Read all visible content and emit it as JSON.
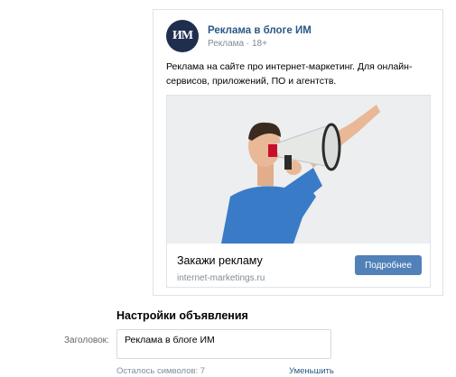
{
  "post": {
    "avatar_text": "ИМ",
    "title": "Реклама в блоге ИМ",
    "subtitle": "Реклама · 18+",
    "text": "Реклама на сайте про интернет-маркетинг. Для онлайн-сервисов, приложений, ПО и агентств."
  },
  "promo": {
    "image_icon": "megaphone-man-photo",
    "title": "Закажи рекламу",
    "domain": "internet-marketings.ru",
    "button_label": "Подробнее"
  },
  "settings": {
    "title": "Настройки объявления",
    "headline_label": "Заголовок:",
    "headline_value": "Реклама в блоге ИМ",
    "chars_left": "Осталось символов: 7",
    "reduce_link": "Уменьшить"
  },
  "colors": {
    "link": "#2a5885",
    "button": "#5181b8",
    "avatar": "#1f2e4d"
  }
}
